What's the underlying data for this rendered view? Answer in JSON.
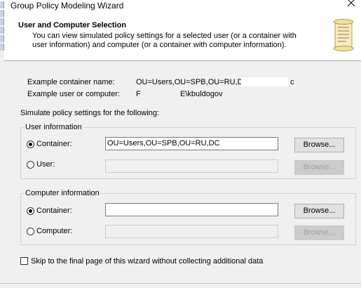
{
  "window": {
    "title": "Group Policy Modeling Wizard"
  },
  "header": {
    "title": "User and Computer Selection",
    "description": "You can view simulated policy settings for a selected user (or a container with user information) and computer (or a container with computer information)."
  },
  "examples": {
    "container_label": "Example container name:",
    "container_value": "OU=Users,OU=SPB,OU=RU,DC=",
    "container_suffix": "c",
    "user_label": "Example user or computer:",
    "user_prefix": "F",
    "user_value": "E\\kbuldogov"
  },
  "simulate_label": "Simulate policy settings for the following:",
  "user_info": {
    "legend": "User information",
    "container_label": "Container:",
    "container_value": "OU=Users,OU=SPB,OU=RU,DC",
    "container_selected": true,
    "user_label": "User:",
    "user_value": "",
    "browse_label": "Browse..."
  },
  "computer_info": {
    "legend": "Computer information",
    "container_label": "Container:",
    "container_value": "",
    "container_selected": true,
    "computer_label": "Computer:",
    "computer_value": "",
    "browse_label": "Browse..."
  },
  "skip_checkbox": {
    "label": "Skip to the final page of this wizard without collecting additional data",
    "checked": false
  },
  "icons": {
    "close": "close-icon",
    "header": "scroll-icon"
  }
}
